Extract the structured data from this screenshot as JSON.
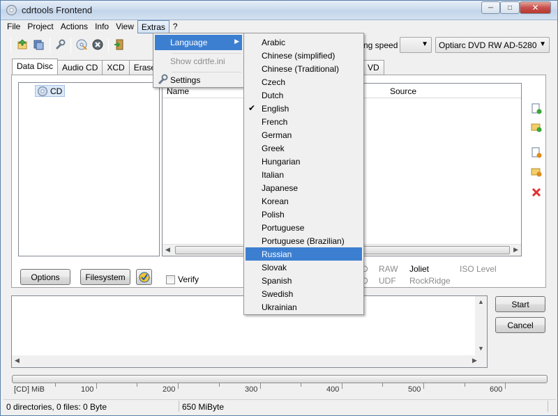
{
  "window": {
    "title": "cdrtools Frontend"
  },
  "menubar": [
    "File",
    "Project",
    "Actions",
    "Info",
    "View",
    "Extras",
    "?"
  ],
  "speed_label": "ng speed",
  "drive": "Optiarc DVD RW AD-5280",
  "tabs": [
    "Data Disc",
    "Audio CD",
    "XCD",
    "Erase",
    "VD"
  ],
  "tree": {
    "root": "CD"
  },
  "filelist": {
    "col_name": "Name",
    "col_source": "Source"
  },
  "buttons": {
    "options": "Options",
    "filesystem": "Filesystem",
    "start": "Start",
    "cancel": "Cancel"
  },
  "verify_label": "Verify",
  "fs_options": {
    "d1": "D",
    "raw": "RAW",
    "joliet": "Joliet",
    "iso_level": "ISO Level",
    "d2": "D",
    "udf": "UDF",
    "rockridge": "RockRidge"
  },
  "ruler": {
    "unit": "[CD] MiB",
    "ticks": [
      "100",
      "200",
      "300",
      "400",
      "500",
      "600"
    ]
  },
  "status": {
    "files": "0 directories, 0 files: 0 Byte",
    "size": "650 MiByte"
  },
  "extras_menu": {
    "language": "Language",
    "show_ini": "Show cdrtfe.ini",
    "settings": "Settings"
  },
  "languages": [
    "Arabic",
    "Chinese (simplified)",
    "Chinese (Traditional)",
    "Czech",
    "Dutch",
    "English",
    "French",
    "German",
    "Greek",
    "Hungarian",
    "Italian",
    "Japanese",
    "Korean",
    "Polish",
    "Portuguese",
    "Portuguese (Brazilian)",
    "Russian",
    "Slovak",
    "Spanish",
    "Swedish",
    "Ukrainian"
  ],
  "selected_language": "English",
  "highlighted_language": "Russian",
  "colors": {
    "highlight": "#3c7fd1",
    "delete": "#e03030"
  }
}
